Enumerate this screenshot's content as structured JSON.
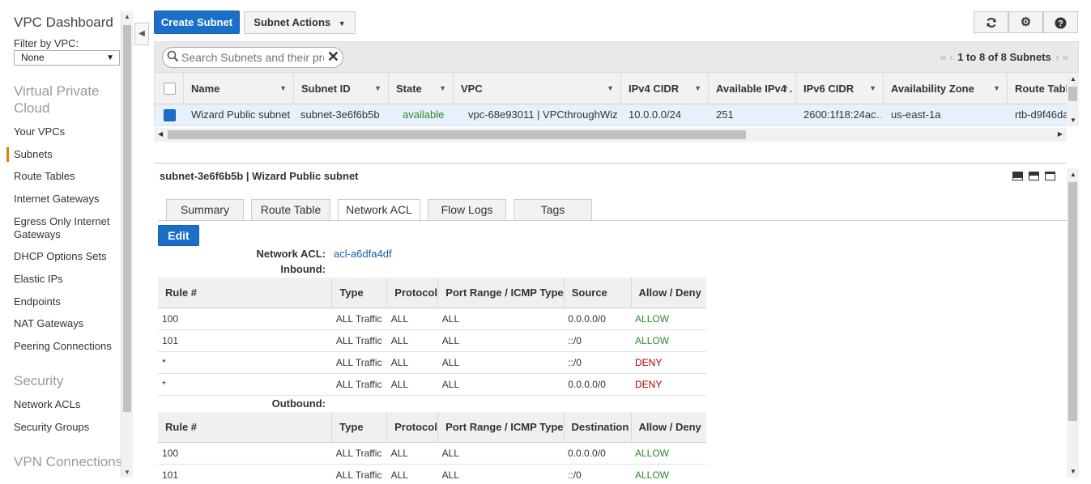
{
  "sidebar": {
    "title": "VPC Dashboard",
    "filter_label": "Filter by VPC:",
    "filter_value": "None",
    "sections": [
      {
        "label": "Virtual Private Cloud",
        "items": [
          "Your VPCs",
          "Subnets",
          "Route Tables",
          "Internet Gateways",
          "Egress Only Internet Gateways",
          "DHCP Options Sets",
          "Elastic IPs",
          "Endpoints",
          "NAT Gateways",
          "Peering Connections"
        ]
      },
      {
        "label": "Security",
        "items": [
          "Network ACLs",
          "Security Groups"
        ]
      },
      {
        "label": "VPN Connections",
        "items": []
      }
    ],
    "active_item": "Subnets"
  },
  "toolbar": {
    "create_label": "Create Subnet",
    "actions_label": "Subnet Actions",
    "icons": [
      "refresh-icon",
      "gear-icon",
      "help-icon"
    ]
  },
  "search": {
    "placeholder": "Search Subnets and their properties"
  },
  "pager": {
    "text": "1 to 8 of 8 Subnets"
  },
  "grid": {
    "columns": [
      "Name",
      "Subnet ID",
      "State",
      "VPC",
      "IPv4 CIDR",
      "Available IPv4 .",
      "IPv6 CIDR",
      "Availability Zone",
      "Route Table"
    ],
    "rows": [
      [
        "Wizard Public subnet",
        "subnet-3e6f6b5b",
        "available",
        "vpc-68e93011 | VPCthroughWiz…",
        "10.0.0.0/24",
        "251",
        "2600:1f18:24ac…",
        "us-east-1a",
        "rtb-d9f46da"
      ]
    ]
  },
  "detail": {
    "title": "subnet-3e6f6b5b | Wizard Public subnet",
    "tabs": [
      "Summary",
      "Route Table",
      "Network ACL",
      "Flow Logs",
      "Tags"
    ],
    "active_tab": "Network ACL",
    "edit_label": "Edit",
    "network_acl_label": "Network ACL:",
    "network_acl_value": "acl-a6dfa4df",
    "inbound_label": "Inbound:",
    "outbound_label": "Outbound:",
    "inbound_headers": [
      "Rule #",
      "Type",
      "Protocol",
      "Port Range / ICMP Type",
      "Source",
      "Allow / Deny"
    ],
    "inbound_rows": [
      [
        "100",
        "ALL Traffic",
        "ALL",
        "ALL",
        "0.0.0.0/0",
        "ALLOW"
      ],
      [
        "101",
        "ALL Traffic",
        "ALL",
        "ALL",
        "::/0",
        "ALLOW"
      ],
      [
        "*",
        "ALL Traffic",
        "ALL",
        "ALL",
        "::/0",
        "DENY"
      ],
      [
        "*",
        "ALL Traffic",
        "ALL",
        "ALL",
        "0.0.0.0/0",
        "DENY"
      ]
    ],
    "outbound_headers": [
      "Rule #",
      "Type",
      "Protocol",
      "Port Range / ICMP Type",
      "Destination",
      "Allow / Deny"
    ],
    "outbound_rows": [
      [
        "100",
        "ALL Traffic",
        "ALL",
        "ALL",
        "0.0.0.0/0",
        "ALLOW"
      ],
      [
        "101",
        "ALL Traffic",
        "ALL",
        "ALL",
        "::/0",
        "ALLOW"
      ]
    ]
  },
  "colors": {
    "primary": "#1a6fc9",
    "allow": "#2a8a2a",
    "deny": "#b00000",
    "active_nav": "#e87b00"
  }
}
